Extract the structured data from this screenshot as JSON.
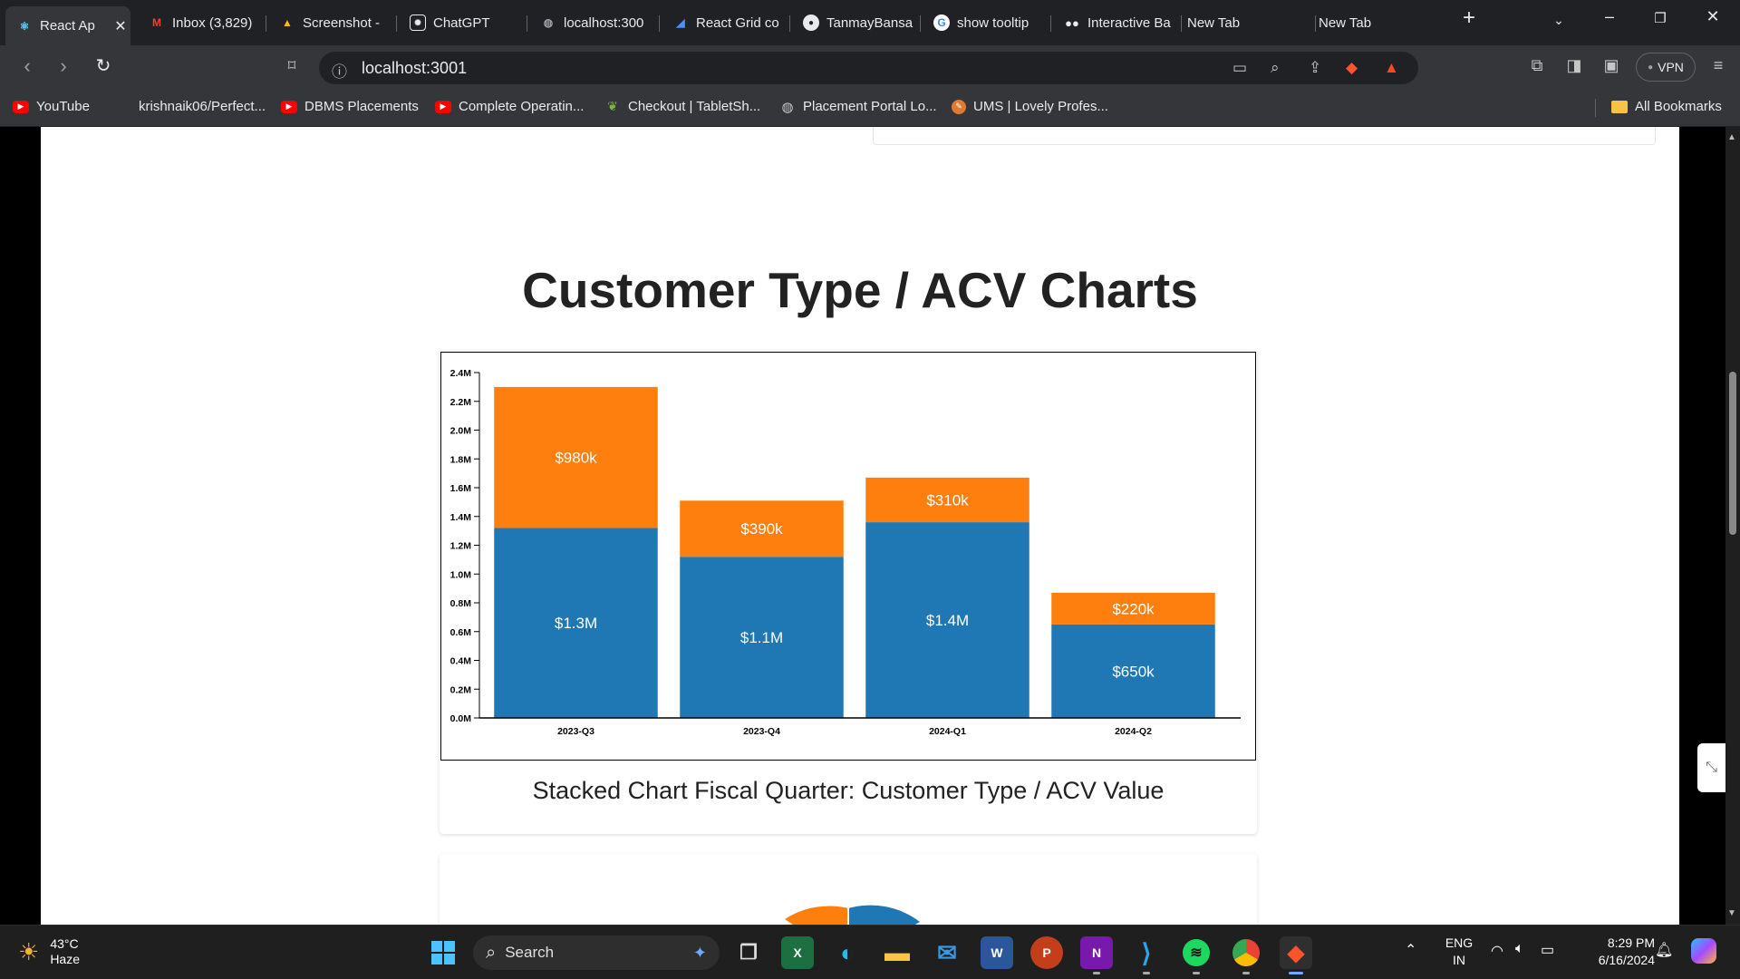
{
  "browser": {
    "tabs": [
      {
        "title": "React Ap",
        "favicon": "react-icon",
        "active": true
      },
      {
        "title": "Inbox (3,829)",
        "favicon": "gmail-icon"
      },
      {
        "title": "Screenshot -",
        "favicon": "drive-icon"
      },
      {
        "title": "ChatGPT",
        "favicon": "chatgpt-icon"
      },
      {
        "title": "localhost:300",
        "favicon": "globe-icon"
      },
      {
        "title": "React Grid co",
        "favicon": "mui-icon"
      },
      {
        "title": "TanmayBansa",
        "favicon": "github-icon"
      },
      {
        "title": "show tooltip",
        "favicon": "google-icon"
      },
      {
        "title": "Interactive Ba",
        "favicon": "medium-icon"
      },
      {
        "title": "New Tab",
        "favicon": ""
      },
      {
        "title": "New Tab",
        "favicon": ""
      }
    ],
    "url": "localhost:3001",
    "vpn_label": "VPN",
    "bookmarks": [
      {
        "label": "YouTube",
        "icon": "youtube-icon"
      },
      {
        "label": "krishnaik06/Perfect...",
        "icon": "github-icon"
      },
      {
        "label": "DBMS Placements",
        "icon": "youtube-icon"
      },
      {
        "label": "Complete Operatin...",
        "icon": "youtube-icon"
      },
      {
        "label": "Checkout | TabletSh...",
        "icon": "leaf-icon"
      },
      {
        "label": "Placement Portal Lo...",
        "icon": "globe-icon"
      },
      {
        "label": "UMS | Lovely Profes...",
        "icon": "ums-icon"
      }
    ],
    "all_bookmarks_label": "All Bookmarks"
  },
  "page": {
    "section_title": "Customer Type / ACV Charts",
    "chart_caption": "Stacked Chart Fiscal Quarter: Customer Type / ACV Value"
  },
  "chart_data": {
    "type": "bar",
    "stacked": true,
    "categories": [
      "2023-Q3",
      "2023-Q4",
      "2024-Q1",
      "2024-Q2"
    ],
    "series": [
      {
        "color": "#1f77b4",
        "values": [
          1320000,
          1120000,
          1360000,
          650000
        ],
        "labels": [
          "$1.3M",
          "$1.1M",
          "$1.4M",
          "$650k"
        ]
      },
      {
        "color": "#ff7f0e",
        "values": [
          980000,
          390000,
          310000,
          220000
        ],
        "labels": [
          "$980k",
          "$390k",
          "$310k",
          "$220k"
        ]
      }
    ],
    "ylim": [
      0,
      2400000
    ],
    "yticks": [
      "0.0M",
      "0.2M",
      "0.4M",
      "0.6M",
      "0.8M",
      "1.0M",
      "1.2M",
      "1.4M",
      "1.6M",
      "1.8M",
      "2.0M",
      "2.2M",
      "2.4M"
    ],
    "title": "",
    "xlabel": "",
    "ylabel": "",
    "grid": false
  },
  "taskbar": {
    "weather_temp": "43°C",
    "weather_desc": "Haze",
    "search_label": "Search",
    "lang_top": "ENG",
    "lang_bottom": "IN",
    "time": "8:29 PM",
    "date": "6/16/2024"
  }
}
